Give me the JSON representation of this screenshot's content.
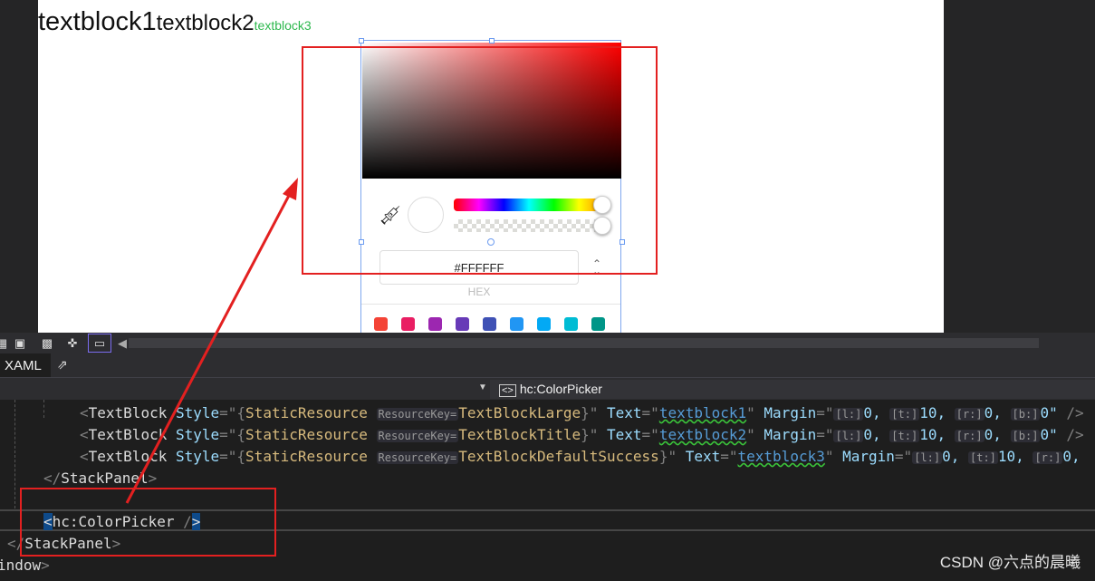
{
  "designer": {
    "textblocks": [
      "textblock1",
      "textblock2",
      "textblock3"
    ],
    "color_picker": {
      "hex_value": "#FFFFFF",
      "hex_label": "HEX",
      "swatches": [
        "#f44336",
        "#e91e63",
        "#9c27b0",
        "#673ab7",
        "#3f51b5",
        "#2196f3",
        "#03a9f4",
        "#00bcd4",
        "#009688"
      ]
    }
  },
  "toolbar": {
    "icons": [
      "grid-icon",
      "snap-icon",
      "checker-icon",
      "pan-icon",
      "device-icon"
    ]
  },
  "editor": {
    "tab_label": "XAML",
    "element_selector": "hc:ColorPicker",
    "lines": [
      [
        {
          "t": "<",
          "k": "punct"
        },
        {
          "t": "TextBlock",
          "k": "tag"
        },
        {
          "t": " Style",
          "k": "attr"
        },
        {
          "t": "=\"{",
          "k": "punct"
        },
        {
          "t": "StaticResource ",
          "k": "res"
        },
        {
          "t": "ResourceKey=",
          "k": "hint"
        },
        {
          "t": "TextBlockLarge",
          "k": "res"
        },
        {
          "t": "}\"",
          "k": "punct"
        },
        {
          "t": " Text",
          "k": "attr"
        },
        {
          "t": "=\"",
          "k": "punct"
        },
        {
          "t": "textblock1",
          "k": "val"
        },
        {
          "t": "\"",
          "k": "punct"
        },
        {
          "t": " Margin",
          "k": "attr"
        },
        {
          "t": "=\"",
          "k": "punct"
        },
        {
          "t": "[l:]",
          "k": "hint"
        },
        {
          "t": "0, ",
          "k": "attr"
        },
        {
          "t": "[t:]",
          "k": "hint"
        },
        {
          "t": "10, ",
          "k": "attr"
        },
        {
          "t": "[r:]",
          "k": "hint"
        },
        {
          "t": "0, ",
          "k": "attr"
        },
        {
          "t": "[b:]",
          "k": "hint"
        },
        {
          "t": "0\"",
          "k": "attr"
        },
        {
          "t": " />",
          "k": "punct"
        }
      ],
      [
        {
          "t": "<",
          "k": "punct"
        },
        {
          "t": "TextBlock",
          "k": "tag"
        },
        {
          "t": " Style",
          "k": "attr"
        },
        {
          "t": "=\"{",
          "k": "punct"
        },
        {
          "t": "StaticResource ",
          "k": "res"
        },
        {
          "t": "ResourceKey=",
          "k": "hint"
        },
        {
          "t": "TextBlockTitle",
          "k": "res"
        },
        {
          "t": "}\"",
          "k": "punct"
        },
        {
          "t": " Text",
          "k": "attr"
        },
        {
          "t": "=\"",
          "k": "punct"
        },
        {
          "t": "textblock2",
          "k": "val"
        },
        {
          "t": "\"",
          "k": "punct"
        },
        {
          "t": " Margin",
          "k": "attr"
        },
        {
          "t": "=\"",
          "k": "punct"
        },
        {
          "t": "[l:]",
          "k": "hint"
        },
        {
          "t": "0, ",
          "k": "attr"
        },
        {
          "t": "[t:]",
          "k": "hint"
        },
        {
          "t": "10, ",
          "k": "attr"
        },
        {
          "t": "[r:]",
          "k": "hint"
        },
        {
          "t": "0, ",
          "k": "attr"
        },
        {
          "t": "[b:]",
          "k": "hint"
        },
        {
          "t": "0\"",
          "k": "attr"
        },
        {
          "t": " />",
          "k": "punct"
        }
      ],
      [
        {
          "t": "<",
          "k": "punct"
        },
        {
          "t": "TextBlock",
          "k": "tag"
        },
        {
          "t": " Style",
          "k": "attr"
        },
        {
          "t": "=\"{",
          "k": "punct"
        },
        {
          "t": "StaticResource ",
          "k": "res"
        },
        {
          "t": "ResourceKey=",
          "k": "hint"
        },
        {
          "t": "TextBlockDefaultSuccess",
          "k": "res"
        },
        {
          "t": "}\"",
          "k": "punct"
        },
        {
          "t": " Text",
          "k": "attr"
        },
        {
          "t": "=\"",
          "k": "punct"
        },
        {
          "t": "textblock3",
          "k": "val"
        },
        {
          "t": "\"",
          "k": "punct"
        },
        {
          "t": " Margin",
          "k": "attr"
        },
        {
          "t": "=\"",
          "k": "punct"
        },
        {
          "t": "[l:]",
          "k": "hint"
        },
        {
          "t": "0, ",
          "k": "attr"
        },
        {
          "t": "[t:]",
          "k": "hint"
        },
        {
          "t": "10, ",
          "k": "attr"
        },
        {
          "t": "[r:]",
          "k": "hint"
        },
        {
          "t": "0,",
          "k": "attr"
        }
      ],
      [
        {
          "t": "</",
          "k": "punct"
        },
        {
          "t": "StackPanel",
          "k": "tag"
        },
        {
          "t": ">",
          "k": "punct"
        }
      ],
      [],
      [
        {
          "t": "<",
          "k": "brk"
        },
        {
          "t": "hc:ColorPicker",
          "k": "tag"
        },
        {
          "t": " /",
          "k": "punct"
        },
        {
          "t": ">",
          "k": "brk"
        }
      ],
      [
        {
          "t": "</",
          "k": "punct"
        },
        {
          "t": "StackPanel",
          "k": "tag"
        },
        {
          "t": ">",
          "k": "punct"
        }
      ],
      [
        {
          "t": "indow",
          "k": "tag"
        },
        {
          "t": ">",
          "k": "punct"
        }
      ]
    ]
  },
  "watermark": "CSDN @六点的晨曦"
}
